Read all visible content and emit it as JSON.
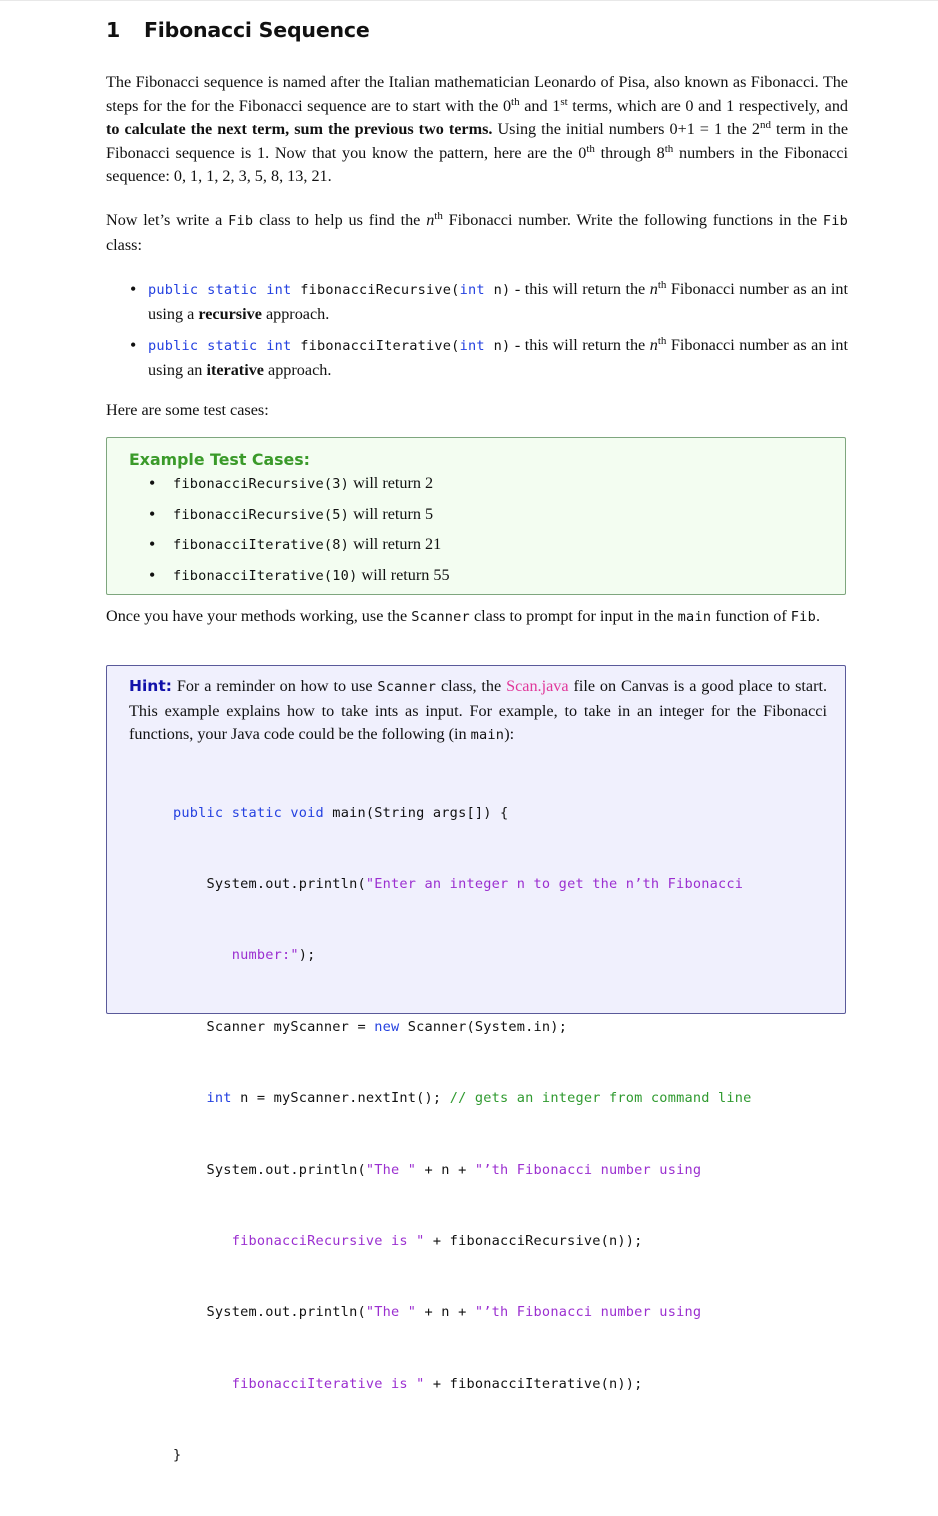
{
  "section": {
    "number": "1",
    "title": "Fibonacci Sequence"
  },
  "intro": {
    "s1": "The Fibonacci sequence is named after the Italian mathematician Leonardo of Pisa, also known as Fibonacci. The steps for the for the Fibonacci sequence are to start with the 0",
    "sup_th": "th",
    "s2": " and 1",
    "sup_st": "st",
    "s3": " terms, which are 0 and 1 respectively, and ",
    "bold": "to calculate the next term, sum the previous two terms.",
    "s4": " Using the initial numbers 0+1 = 1 the 2",
    "sup_nd": "nd",
    "s5": " term in the Fibonacci sequence is 1. Now that you know the pattern, here are the 0",
    "s6": " through 8",
    "s7": " numbers in the Fibonacci sequence: 0, 1, 1, 2, 3, 5, 8, 13, 21."
  },
  "fib_class": {
    "s1": "Now let’s write a ",
    "code1": "Fib",
    "s2": " class to help us find the ",
    "n": "n",
    "sup": "th",
    "s3": " Fibonacci number. Write the following functions in the ",
    "code2": "Fib",
    "s4": " class:"
  },
  "functions": [
    {
      "kw1": "public static int",
      "name": " fibonacciRecursive(",
      "kw2": "int",
      "param": " n)",
      "desc1": " - this will return the ",
      "n": "n",
      "sup": "th",
      "desc2": " Fibonacci number as an int using a ",
      "bold": "recursive",
      "desc3": " approach."
    },
    {
      "kw1": "public static int",
      "name": " fibonacciIterative(",
      "kw2": "int",
      "param": " n)",
      "desc1": " - this will return the ",
      "n": "n",
      "sup": "th",
      "desc2": " Fibonacci number as an int using an ",
      "bold": "iterative",
      "desc3": " approach."
    }
  ],
  "test_intro": "Here are some test cases:",
  "test_box": {
    "title": "Example Test Cases:",
    "color_title": "#3a9a2a",
    "cases": [
      {
        "call": "fibonacciRecursive(3)",
        "text": " will return 2"
      },
      {
        "call": "fibonacciRecursive(5)",
        "text": " will return 5"
      },
      {
        "call": "fibonacciIterative(8)",
        "text": " will return 21"
      },
      {
        "call": "fibonacciIterative(10)",
        "text": " will return 55"
      }
    ]
  },
  "scanner_para": {
    "s1": "Once you have your methods working, use the ",
    "code1": "Scanner",
    "s2": " class to prompt for input in the ",
    "code2": "main",
    "s3": " function of ",
    "code3": "Fib",
    "s4": "."
  },
  "hint_box": {
    "label": "Hint:",
    "s1": " For a reminder on how to use ",
    "code1": "Scanner",
    "s2": " class, the ",
    "link": "Scan.java",
    "s3": " file on Canvas is a good place to start. This example explains how to take ints as input. For example, to take in an integer for the Fibonacci functions, your Java code could be the following (in ",
    "code2": "main",
    "s4": "):"
  },
  "code": {
    "l1_kw": "public static void",
    "l1_rest": " main(String args[]) {",
    "l2_a": "    System.out.println(",
    "l2_str": "\"Enter an integer n to get the n’th Fibonacci",
    "l3_str": "       number:\"",
    "l3_rest": ");",
    "l4_a": "    Scanner myScanner = ",
    "l4_kw": "new",
    "l4_b": " Scanner(System.in);",
    "l5_kw": "    int",
    "l5_a": " n = myScanner.nextInt(); ",
    "l5_cmt": "// gets an integer from command line",
    "l6_a": "    System.out.println(",
    "l6_str1": "\"The \"",
    "l6_b": " + n + ",
    "l6_str2": "\"’th Fibonacci number using",
    "l7_str": "       fibonacciRecursive is \"",
    "l7_rest": " + fibonacciRecursive(n));",
    "l8_a": "    System.out.println(",
    "l8_str1": "\"The \"",
    "l8_b": " + n + ",
    "l8_str2": "\"’th Fibonacci number using",
    "l9_str": "       fibonacciIterative is \"",
    "l9_rest": " + fibonacciIterative(n));",
    "l10": "}"
  }
}
